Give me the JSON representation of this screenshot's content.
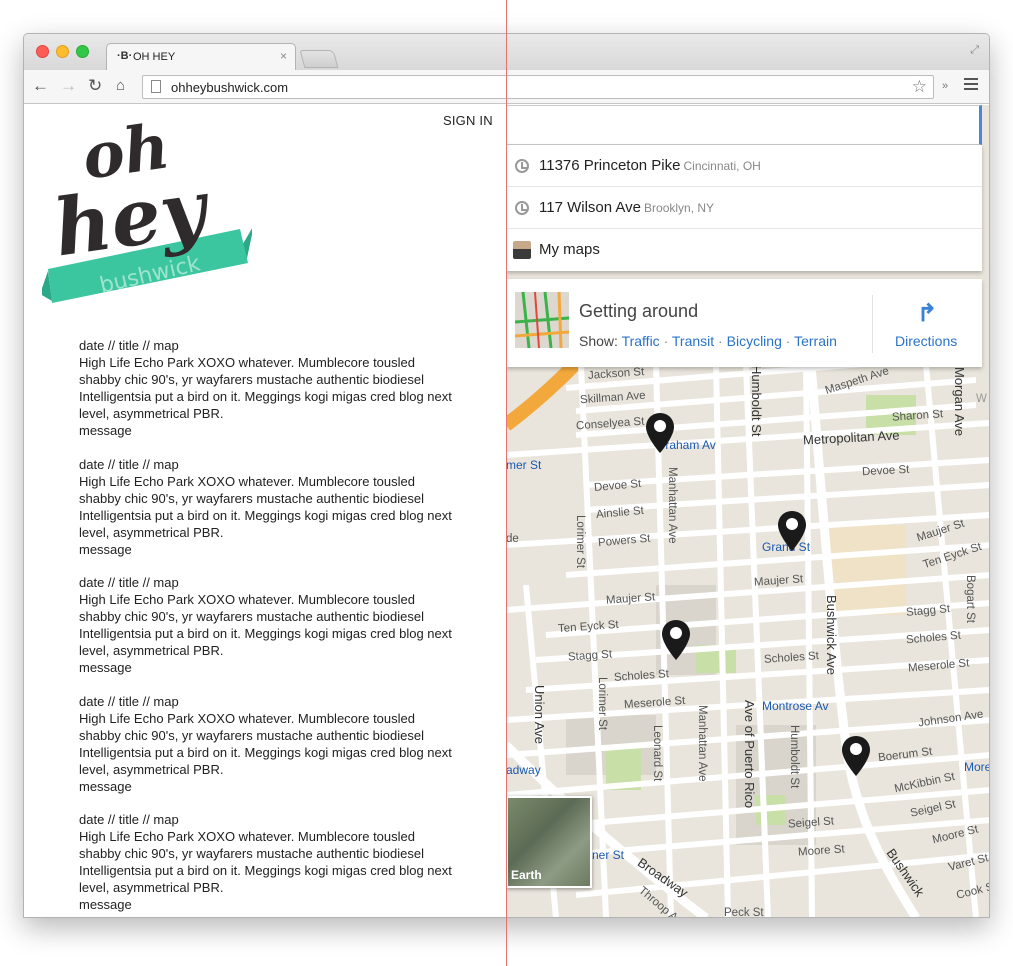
{
  "browser": {
    "tab_title": "OH HEY",
    "tab_favicon": "·B·",
    "tab_close": "×",
    "url": "ohheybushwick.com",
    "extensions_label": "»"
  },
  "page": {
    "sign_in": "SIGN IN",
    "logo_text": {
      "top": "oh",
      "middle": "hey",
      "banner": "bushwick"
    },
    "posts": [
      {
        "header": "date // title // map",
        "body": "High Life Echo Park XOXO whatever. Mumblecore tousled shabby chic 90's, yr wayfarers mustache authentic biodiesel Intelligentsia put a bird on it. Meggings kogi migas cred blog next level, asymmetrical PBR.",
        "footer": "message"
      },
      {
        "header": "date // title // map",
        "body": "High Life Echo Park XOXO whatever. Mumblecore tousled shabby chic 90's, yr wayfarers mustache authentic biodiesel Intelligentsia put a bird on it. Meggings kogi migas cred blog next level, asymmetrical PBR.",
        "footer": "message"
      },
      {
        "header": "date // title // map",
        "body": "High Life Echo Park XOXO whatever. Mumblecore tousled shabby chic 90's, yr wayfarers mustache authentic biodiesel Intelligentsia put a bird on it. Meggings kogi migas cred blog next level, asymmetrical PBR.",
        "footer": "message"
      },
      {
        "header": "date // title // map",
        "body": "High Life Echo Park XOXO whatever. Mumblecore tousled shabby chic 90's, yr wayfarers mustache authentic biodiesel Intelligentsia put a bird on it. Meggings kogi migas cred blog next level, asymmetrical PBR.",
        "footer": "message"
      },
      {
        "header": "date // title // map",
        "body": "High Life Echo Park XOXO whatever. Mumblecore tousled shabby chic 90's, yr wayfarers mustache authentic biodiesel Intelligentsia put a bird on it. Meggings kogi migas cred blog next level, asymmetrical PBR.",
        "footer": "message"
      }
    ]
  },
  "map": {
    "suggestions": [
      {
        "main": "11376 Princeton Pike",
        "sub": "Cincinnati, OH",
        "icon": "clock-icon"
      },
      {
        "main": "117 Wilson Ave",
        "sub": "Brooklyn, NY",
        "icon": "clock-icon"
      },
      {
        "main": "My maps",
        "sub": "",
        "icon": "avatar"
      }
    ],
    "getting_around": {
      "title": "Getting around",
      "show_label": "Show:",
      "links": [
        "Traffic",
        "Transit",
        "Bicycling",
        "Terrain"
      ],
      "directions": "Directions"
    },
    "earth_label": "Earth",
    "labels": {
      "jackson": "Jackson St",
      "skillman": "Skillman Ave",
      "conselyea": "Conselyea St",
      "graham": "Graham Av",
      "metropolitan": "Metropolitan Ave",
      "maspeth": "Maspeth Ave",
      "sharon": "Sharon St",
      "devoe_e": "Devoe St",
      "devoe_w": "Devoe St",
      "ainslie": "Ainslie St",
      "powers": "Powers St",
      "grand": "Grand St",
      "maujer_e": "Maujer St",
      "maujer_mid": "Maujer St",
      "maujer_w": "Maujer St",
      "teneyck_e": "Ten Eyck St",
      "teneyck_w": "Ten Eyck St",
      "stagg_e": "Stagg St",
      "stagg_w": "Stagg St",
      "scholes_e": "Scholes St",
      "scholes_mid": "Scholes St",
      "scholes_w": "Scholes St",
      "meserole_e": "Meserole St",
      "meserole_w": "Meserole St",
      "montrose": "Montrose Av",
      "johnson": "Johnson Ave",
      "boerum": "Boerum St",
      "mckibbin": "McKibbin St",
      "seigel_e": "Seigel St",
      "seigel_w": "Seigel St",
      "moore_e": "Moore St",
      "moore_w": "Moore St",
      "varet": "Varet St",
      "cook": "Cook St",
      "lorimer_n": "Lorimer St",
      "lorimer_s": "Lorimer St",
      "manhattan_n": "Manhattan Ave",
      "manhattan_s": "Manhattan Ave",
      "humboldt_n": "Humboldt St",
      "humboldt_s": "Humboldt St",
      "bushwick": "Bushwick Ave",
      "bushwick_lower": "Bushwick",
      "union": "Union Ave",
      "leonard": "Leonard St",
      "puerto_rico": "Ave of Puerto Rico",
      "broadway_lbl": "Broadway",
      "broadway_station": "adway",
      "lorimer_station": "mer St",
      "lorimer_station2": "ner St",
      "bogart": "Bogart St",
      "morgan": "Morgan Ave",
      "throop": "Throop Av",
      "peck": "Peck St",
      "more": "More",
      "w_label": "W",
      "de_label": "de"
    },
    "pins": [
      {
        "name": "pin-graham"
      },
      {
        "name": "pin-grand"
      },
      {
        "name": "pin-ten-eyck"
      },
      {
        "name": "pin-boerum"
      }
    ],
    "colors": {
      "land": "#e9e5dc",
      "road": "#ffffff",
      "highway": "#f3a83b",
      "park": "#c9dfa8",
      "block": "#d9d5cc",
      "pin": "#1a1a1a",
      "link": "#2a73c9",
      "logo_dark": "#2f2a2b",
      "logo_teal": "#3cc6a0"
    }
  }
}
